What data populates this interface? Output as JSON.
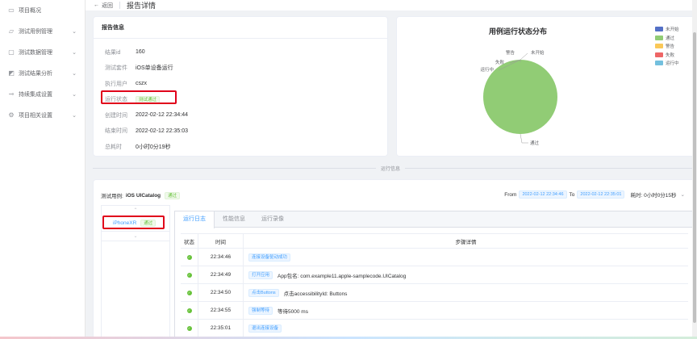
{
  "sidebar": {
    "items": [
      {
        "icon": "desktop-icon",
        "glyph": "▭",
        "label": "项目概况",
        "has_children": false
      },
      {
        "icon": "folder-icon",
        "glyph": "▱",
        "label": "测试用例管理",
        "has_children": true
      },
      {
        "icon": "lock-icon",
        "glyph": "▢",
        "label": "测试数据管理",
        "has_children": true
      },
      {
        "icon": "chart-icon",
        "glyph": "◩",
        "label": "测试结果分析",
        "has_children": true
      },
      {
        "icon": "link-icon",
        "glyph": "⊸",
        "label": "持续集成设置",
        "has_children": true
      },
      {
        "icon": "gear-icon",
        "glyph": "⚙",
        "label": "项目相关设置",
        "has_children": true
      }
    ]
  },
  "topbar": {
    "back_label": "返回",
    "title": "报告详情"
  },
  "report_info": {
    "title": "报告信息",
    "rows": [
      {
        "label": "结果id",
        "value": "160"
      },
      {
        "label": "测试套件",
        "value": "iOS单设备运行"
      },
      {
        "label": "执行用户",
        "value": "cszx"
      },
      {
        "label": "运行状态",
        "value": "测试通过",
        "is_tag": true
      },
      {
        "label": "创建时间",
        "value": "2022-02-12 22:34:44"
      },
      {
        "label": "结束时间",
        "value": "2022-02-12 22:35:03"
      },
      {
        "label": "总耗时",
        "value": "0小时0分19秒"
      }
    ]
  },
  "chart_data": {
    "type": "pie",
    "title": "用例运行状态分布",
    "categories": [
      "未开始",
      "通过",
      "警告",
      "失败",
      "运行中"
    ],
    "values": [
      0,
      1,
      0,
      0,
      0
    ],
    "colors": [
      "#5470c6",
      "#91cc75",
      "#fac858",
      "#ee6666",
      "#73c0de"
    ],
    "legend_position": "top-right",
    "slice_labels": [
      "警告",
      "未开始",
      "失败",
      "运行中",
      "通过"
    ]
  },
  "section_label": "运行信息",
  "run": {
    "case_prefix": "测试用例:",
    "case_name": "iOS UICatalog",
    "case_status": "通过",
    "from_label": "From",
    "from_value": "2022-02-12 22:34:46",
    "to_label": "To",
    "to_value": "2022-02-12 22:35:01",
    "duration": "耗时: 0小时0分15秒",
    "device": {
      "name": "iPhoneXR",
      "status": "通过"
    },
    "tabs": [
      "运行日志",
      "性能信息",
      "运行录像"
    ],
    "active_tab": 0,
    "columns": {
      "status": "状态",
      "time": "时间",
      "step": "步骤详情"
    },
    "steps": [
      {
        "time": "22:34:46",
        "tag": "连接设备驱动成功",
        "detail": ""
      },
      {
        "time": "22:34:49",
        "tag": "打开应用",
        "detail": "App包名: com.example11.apple-samplecode.UICatalog"
      },
      {
        "time": "22:34:50",
        "tag": "点击Buttons",
        "detail": "点击accessibilityId: Buttons"
      },
      {
        "time": "22:34:55",
        "tag": "强制等待",
        "detail": "等待5000 ms"
      },
      {
        "time": "22:35:01",
        "tag": "退出连接设备",
        "detail": ""
      }
    ]
  }
}
